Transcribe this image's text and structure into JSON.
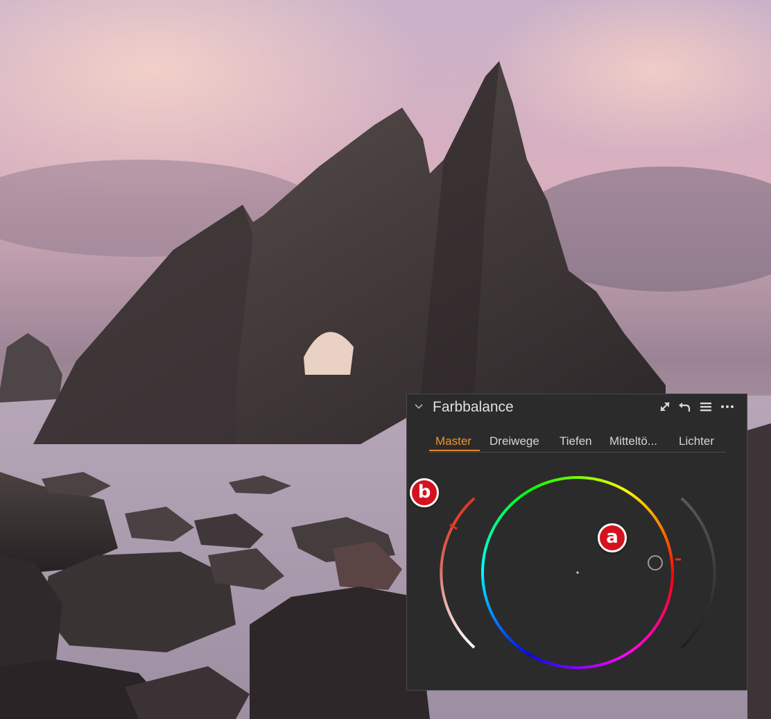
{
  "panel": {
    "title": "Farbbalance",
    "icons": [
      "collapse-chevron-icon",
      "expand-icon",
      "reset-icon",
      "menu-icon",
      "more-icon"
    ],
    "tabs": [
      {
        "label": "Master",
        "active": true
      },
      {
        "label": "Dreiwege",
        "active": false
      },
      {
        "label": "Tiefen",
        "active": false
      },
      {
        "label": "Mitteltö...",
        "active": false
      },
      {
        "label": "Lichter",
        "active": false
      }
    ],
    "accent_color": "#e8892a"
  },
  "annotations": {
    "a": "a",
    "b": "b"
  },
  "colors": {
    "badge": "#d4121f",
    "panel_bg": "#2b2b2b"
  }
}
